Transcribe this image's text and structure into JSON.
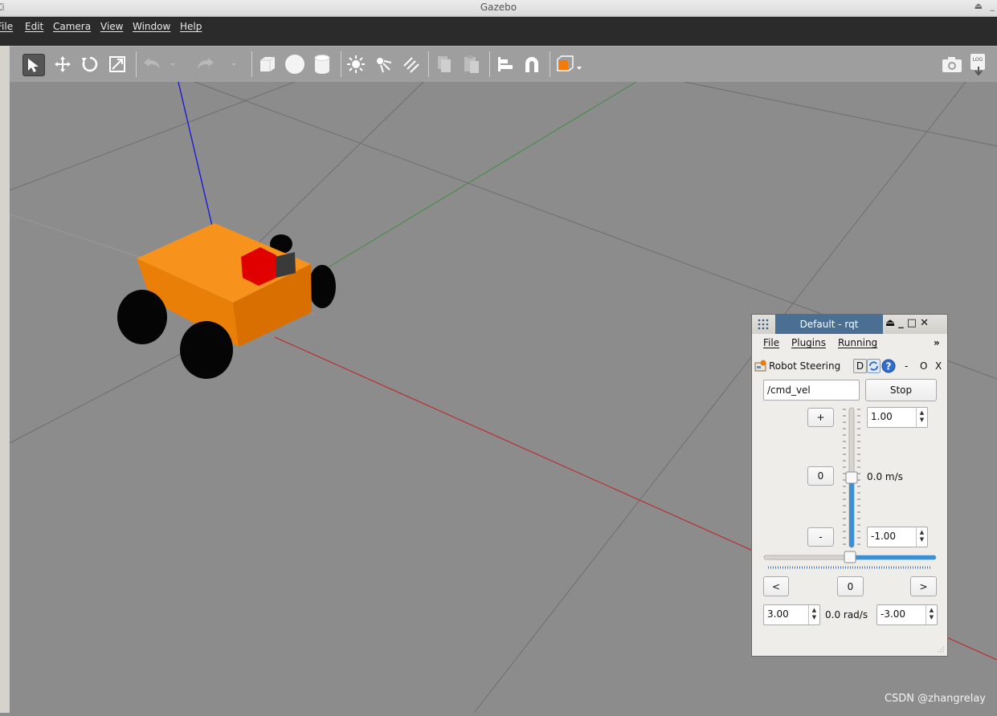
{
  "window": {
    "title": "Gazebo",
    "app_icon": "gazebo-logo-icon",
    "controls": [
      "⏏",
      "_"
    ]
  },
  "menubar": {
    "items": [
      {
        "label": "File"
      },
      {
        "label": "Edit"
      },
      {
        "label": "Camera"
      },
      {
        "label": "View"
      },
      {
        "label": "Window"
      },
      {
        "label": "Help"
      }
    ]
  },
  "toolbar": {
    "tools": [
      {
        "name": "select-mode",
        "icon": "arrow-pointer-icon",
        "active": true
      },
      {
        "name": "translate-mode",
        "icon": "move-arrows-icon"
      },
      {
        "name": "rotate-mode",
        "icon": "rotate-icon"
      },
      {
        "name": "scale-mode",
        "icon": "scale-icon"
      },
      {
        "name": "undo",
        "icon": "undo-icon"
      },
      {
        "name": "redo",
        "icon": "redo-icon"
      },
      {
        "name": "box-shape",
        "icon": "box-icon"
      },
      {
        "name": "sphere-shape",
        "icon": "sphere-icon"
      },
      {
        "name": "cylinder-shape",
        "icon": "cylinder-icon"
      },
      {
        "name": "point-light",
        "icon": "sun-icon"
      },
      {
        "name": "spot-light",
        "icon": "spotlight-icon"
      },
      {
        "name": "directional-light",
        "icon": "directional-light-icon"
      },
      {
        "name": "copy",
        "icon": "copy-icon"
      },
      {
        "name": "paste",
        "icon": "paste-icon"
      },
      {
        "name": "align",
        "icon": "align-icon"
      },
      {
        "name": "snap",
        "icon": "magnet-icon"
      },
      {
        "name": "view-angle",
        "icon": "view-cube-icon"
      }
    ],
    "right_tools": [
      {
        "name": "screenshot",
        "icon": "camera-icon"
      },
      {
        "name": "log",
        "icon": "log-icon",
        "label": "LOG"
      }
    ]
  },
  "viewport": {
    "ground_color": "#8c8c8c",
    "robot_body_color": "#f58a0c",
    "sensor_color": "#e10000",
    "wheel_color": "#050505"
  },
  "rqt": {
    "title": "Default - rqt",
    "controls": [
      "⏏",
      "_",
      "□",
      "✕"
    ],
    "menu": [
      {
        "label": "File"
      },
      {
        "label": "Plugins"
      },
      {
        "label": "Running"
      }
    ],
    "menu_more": "»",
    "plugin": {
      "name": "Robot Steering",
      "d_label": "D",
      "minus": "-",
      "o_label": "O",
      "x_label": "X"
    },
    "topic": "/cmd_vel",
    "stop_label": "Stop",
    "linear": {
      "plus_label": "+",
      "zero_label": "0",
      "minus_label": "-",
      "max": "1.00",
      "min": "-1.00",
      "readout": "0.0 m/s",
      "level": 0.0
    },
    "angular": {
      "left_label": "<",
      "zero_label": "0",
      "right_label": ">",
      "max": "3.00",
      "min": "-3.00",
      "readout": "0.0 rad/s",
      "level": 0.0
    }
  },
  "watermark": "CSDN @zhangrelay"
}
